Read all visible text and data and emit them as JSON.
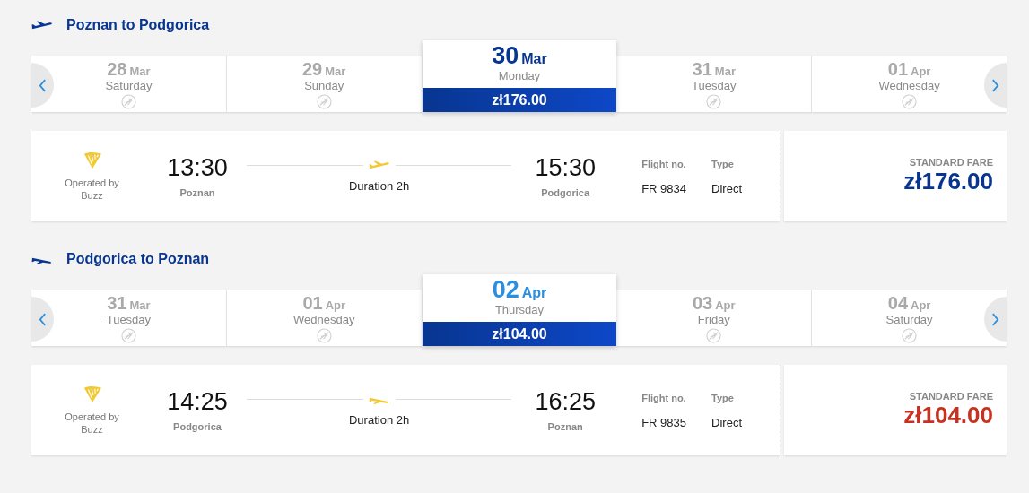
{
  "journeys": [
    {
      "kind": "outbound",
      "title": "Poznan to Podgorica",
      "dates": [
        {
          "day": "28",
          "month": "Mar",
          "weekday": "Saturday",
          "selected": false
        },
        {
          "day": "29",
          "month": "Mar",
          "weekday": "Sunday",
          "selected": false
        },
        {
          "day": "30",
          "month": "Mar",
          "weekday": "Monday",
          "selected": true,
          "price": "zł176.00",
          "color": "#073590"
        },
        {
          "day": "31",
          "month": "Mar",
          "weekday": "Tuesday",
          "selected": false
        },
        {
          "day": "01",
          "month": "Apr",
          "weekday": "Wednesday",
          "selected": false
        }
      ],
      "flight": {
        "operated_by": "Operated by Buzz",
        "departure_time": "13:30",
        "departure_city": "Poznan",
        "duration": "Duration 2h",
        "arrival_time": "15:30",
        "arrival_city": "Podgorica",
        "flight_no_label": "Flight no.",
        "flight_no": "FR 9834",
        "type_label": "Type",
        "type": "Direct",
        "fare_label": "STANDARD FARE",
        "fare": "zł176.00",
        "color": "#073590"
      }
    },
    {
      "kind": "inbound",
      "title": "Podgorica to Poznan",
      "dates": [
        {
          "day": "31",
          "month": "Mar",
          "weekday": "Tuesday",
          "selected": false
        },
        {
          "day": "01",
          "month": "Apr",
          "weekday": "Wednesday",
          "selected": false
        },
        {
          "day": "02",
          "month": "Apr",
          "weekday": "Thursday",
          "selected": true,
          "price": "zł104.00",
          "color": "#2a8fe0"
        },
        {
          "day": "03",
          "month": "Apr",
          "weekday": "Friday",
          "selected": false
        },
        {
          "day": "04",
          "month": "Apr",
          "weekday": "Saturday",
          "selected": false
        }
      ],
      "flight": {
        "operated_by": "Operated by Buzz",
        "departure_time": "14:25",
        "departure_city": "Podgorica",
        "duration": "Duration 2h",
        "arrival_time": "16:25",
        "arrival_city": "Poznan",
        "flight_no_label": "Flight no.",
        "flight_no": "FR 9835",
        "type_label": "Type",
        "type": "Direct",
        "fare_label": "STANDARD FARE",
        "fare": "zł104.00",
        "color": "#c8311f"
      }
    }
  ]
}
